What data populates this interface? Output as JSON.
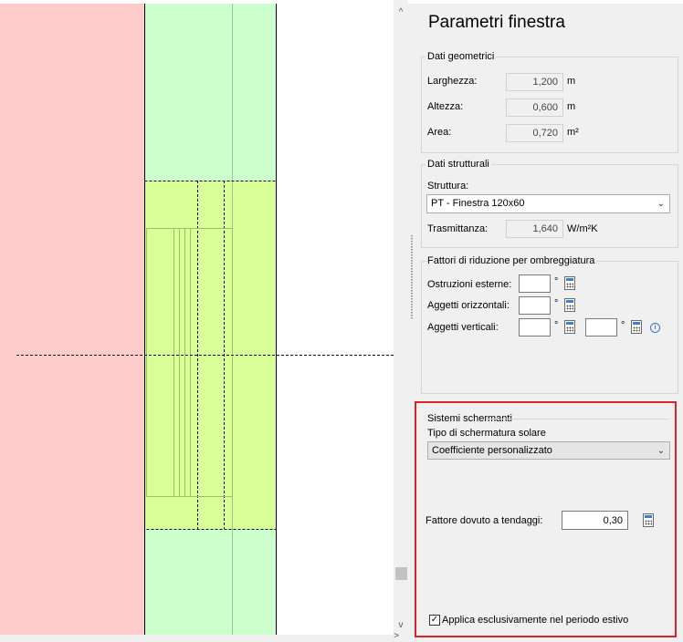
{
  "panel": {
    "title": "Parametri finestra",
    "geom": {
      "legend": "Dati geometrici",
      "rows": [
        {
          "label": "Larghezza:",
          "value": "1,200",
          "unit": "m"
        },
        {
          "label": "Altezza:",
          "value": "0,600",
          "unit": "m"
        },
        {
          "label": "Area:",
          "value": "0,720",
          "unit": "m²"
        }
      ]
    },
    "struct": {
      "legend": "Dati strutturali",
      "struttura_label": "Struttura:",
      "struttura_value": "PT - Finestra 120x60",
      "trasm_label": "Trasmittanza:",
      "trasm_value": "1,640",
      "trasm_unit": "W/m²K"
    },
    "shade": {
      "legend": "Fattori di riduzione per ombreggiatura",
      "ostruzioni_label": "Ostruzioni esterne:",
      "orizzontali_label": "Aggetti orizzontali:",
      "verticali_label": "Aggetti verticali:",
      "deg": "°"
    },
    "screens": {
      "legend": "Sistemi schermanti",
      "tipo_label": "Tipo di schermatura solare",
      "tipo_value": "Coefficiente personalizzato",
      "fattore_label": "Fattore dovuto a tendaggi:",
      "fattore_value": "0,30",
      "checkbox_label": "Applica esclusivamente nel periodo estivo",
      "checkbox_mark": "✓"
    }
  },
  "colors": {
    "wall": "#ffcccc",
    "frame": "#ccffcc",
    "window": "#d9ff99",
    "highlight": "#d8232a"
  },
  "icons": {
    "dropdown": "chevron-down-icon",
    "calculator": "calculator-icon",
    "info": "info-icon",
    "scroll_up": "scroll-up-arrow",
    "scroll_down": "scroll-down-arrow"
  },
  "glyphs": {
    "up": "^",
    "down": "v",
    "chev": "⌄",
    "info": "i",
    "right": ">"
  }
}
